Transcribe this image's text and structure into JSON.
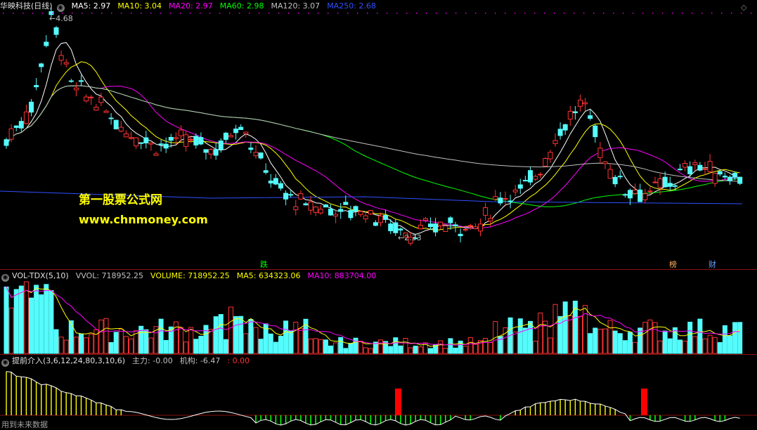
{
  "main_panel": {
    "stock_name": "华映科技(日线)",
    "ma_labels": [
      {
        "text": "MA5: 2.97",
        "color": "#ffffff"
      },
      {
        "text": "MA10: 3.04",
        "color": "#ffff00"
      },
      {
        "text": "MA20: 2.97",
        "color": "#ff00ff"
      },
      {
        "text": "MA60: 2.98",
        "color": "#00ff00"
      },
      {
        "text": "MA120: 3.07",
        "color": "#c0c0c0"
      },
      {
        "text": "MA250: 2.68",
        "color": "#3050ff"
      }
    ],
    "high_label": "4.68",
    "low_label": "2.33",
    "event_tags": [
      {
        "text": "跌",
        "color": "#00ff00"
      },
      {
        "text": "榜",
        "color": "#ffb060"
      },
      {
        "text": "财",
        "color": "#6aa0ff"
      }
    ],
    "watermark_cn": "第一股票公式网",
    "watermark_url": "www.chnmoney.com",
    "menu_icon": "diamond-icon"
  },
  "volume_panel": {
    "indicator": "VOL-TDX(5,10)",
    "labels": [
      {
        "text": "VVOL: 718952.25",
        "color": "#c0c0c0"
      },
      {
        "text": "VOLUME: 718952.25",
        "color": "#ffff00"
      },
      {
        "text": "MA5: 634323.06",
        "color": "#ffff00"
      },
      {
        "text": "MA10: 883704.00",
        "color": "#ff00ff"
      }
    ]
  },
  "signal_panel": {
    "indicator": "提前介入(3,6,12,24,80,3,10,6)",
    "labels": [
      {
        "text": "主力: -0.00",
        "color": "#c0c0c0"
      },
      {
        "text": "机构: -6.47",
        "color": "#c0c0c0"
      },
      {
        "text": ": 0.00",
        "color": "#ff3030"
      }
    ],
    "footer": "用到未来数据"
  },
  "chart_data": [
    {
      "type": "candlestick",
      "title": "华映科技(日线)",
      "y_range": [
        2.33,
        4.68
      ],
      "max_price": 4.68,
      "min_price": 2.33,
      "moving_averages": {
        "MA5": 2.97,
        "MA10": 3.04,
        "MA20": 2.97,
        "MA60": 2.98,
        "MA120": 3.07,
        "MA250": 2.68
      }
    },
    {
      "type": "bar",
      "title": "VOL-TDX(5,10)",
      "series": [
        {
          "name": "VVOL",
          "value": 718952.25
        },
        {
          "name": "VOLUME",
          "value": 718952.25
        },
        {
          "name": "MA5",
          "value": 634323.06
        },
        {
          "name": "MA10",
          "value": 883704.0
        }
      ]
    },
    {
      "type": "bar",
      "title": "提前介入(3,6,12,24,80,3,10,6)",
      "series": [
        {
          "name": "主力",
          "value": -0.0
        },
        {
          "name": "机构",
          "value": -6.47
        }
      ]
    }
  ]
}
